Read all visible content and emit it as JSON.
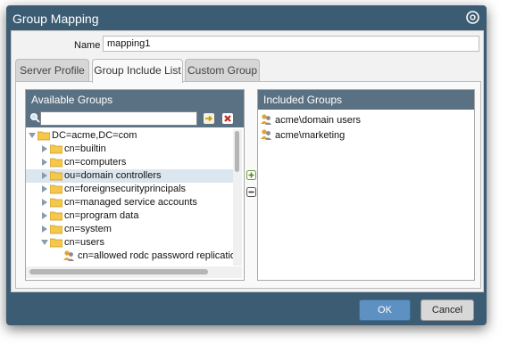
{
  "dialog": {
    "title": "Group Mapping",
    "help_icon": "help-icon"
  },
  "name_field": {
    "label": "Name",
    "value": "mapping1"
  },
  "tabs": [
    {
      "label": "Server Profile",
      "active": false
    },
    {
      "label": "Group Include List",
      "active": true
    },
    {
      "label": "Custom Group",
      "active": false
    }
  ],
  "available": {
    "header": "Available Groups",
    "tree": [
      {
        "label": "DC=acme,DC=com",
        "expanded": true,
        "icon": "folder-icon"
      },
      {
        "label": "cn=builtin",
        "icon": "folder-icon"
      },
      {
        "label": "cn=computers",
        "icon": "folder-icon"
      },
      {
        "label": "ou=domain controllers",
        "icon": "folder-icon",
        "selected": true
      },
      {
        "label": "cn=foreignsecurityprincipals",
        "icon": "folder-icon"
      },
      {
        "label": "cn=managed service accounts",
        "icon": "folder-icon"
      },
      {
        "label": "cn=program data",
        "icon": "folder-icon"
      },
      {
        "label": "cn=system",
        "icon": "folder-icon"
      },
      {
        "label": "cn=users",
        "expanded": true,
        "icon": "folder-icon"
      },
      {
        "label": "cn=allowed rodc password replication gr",
        "icon": "group-icon"
      }
    ]
  },
  "included": {
    "header": "Included Groups",
    "items": [
      {
        "label": "acme\\domain users",
        "icon": "group-icon"
      },
      {
        "label": "acme\\marketing",
        "icon": "group-icon"
      }
    ]
  },
  "footer": {
    "ok_label": "OK",
    "cancel_label": "Cancel"
  },
  "colors": {
    "titlebar": "#3c5c73",
    "panel_header": "#5a7184",
    "ok_button": "#5d91c2",
    "selection": "#dbe6ef"
  }
}
